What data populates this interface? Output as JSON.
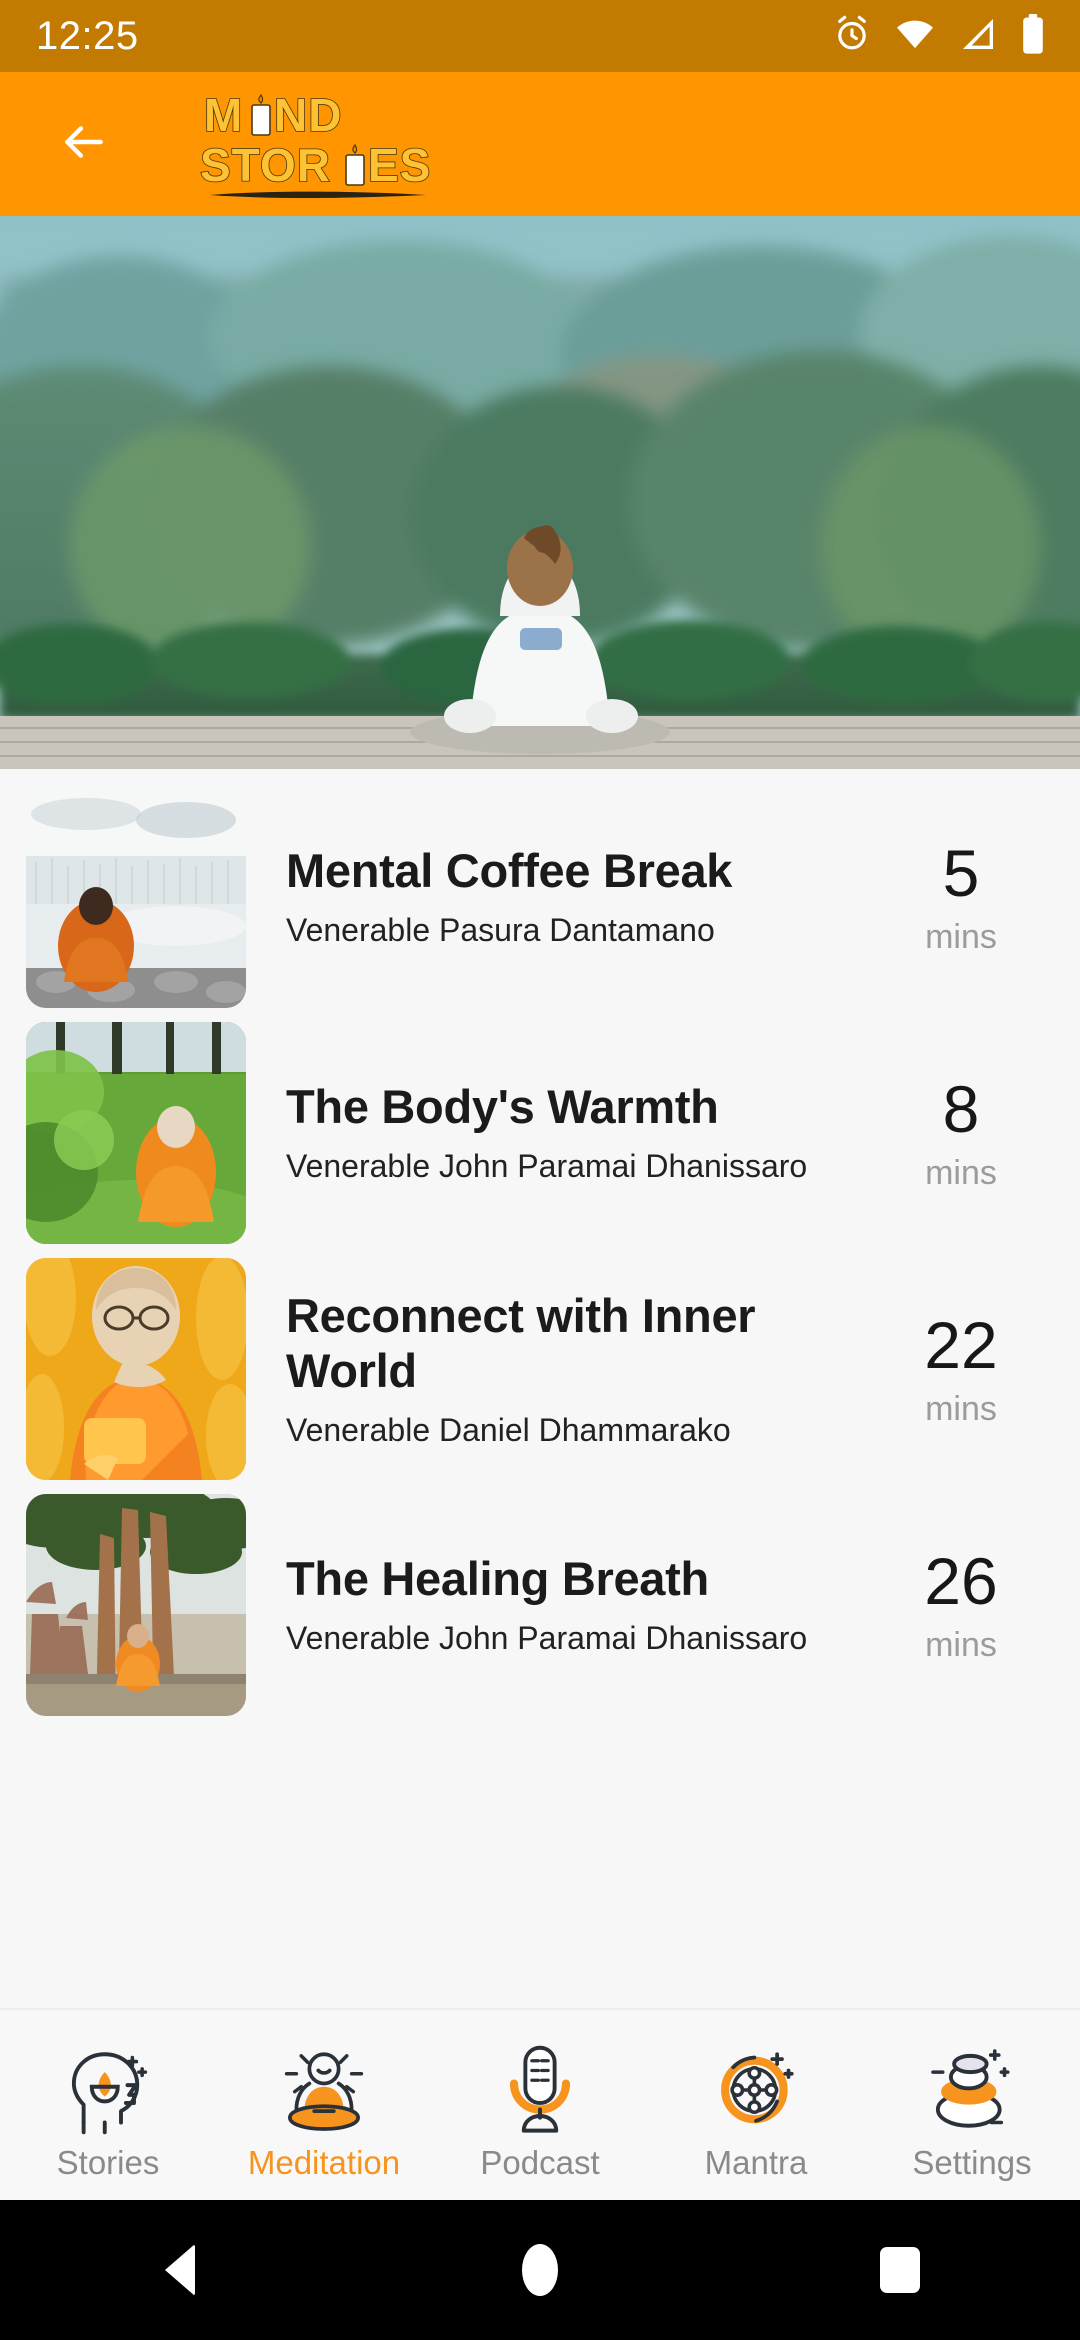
{
  "status_bar": {
    "time": "12:25",
    "icons": [
      "alarm-icon",
      "wifi-icon",
      "signal-icon",
      "battery-icon"
    ],
    "background": "#C27A00"
  },
  "header": {
    "back_icon": "back-arrow-icon",
    "logo_line1": "MIND",
    "logo_line2": "STORIES",
    "background": "#FF9500",
    "logo_fill": "#FFC233"
  },
  "hero": {
    "alt": "person meditating outdoors facing forest"
  },
  "list": {
    "items": [
      {
        "title": "Mental Coffee Break",
        "author": "Venerable Pasura Dantamano",
        "minutes": "5",
        "minutes_label": "mins",
        "thumb": "monk-by-lake"
      },
      {
        "title": "The Body's Warmth",
        "author": "Venerable John Paramai Dhanissaro",
        "minutes": "8",
        "minutes_label": "mins",
        "thumb": "monk-on-grass"
      },
      {
        "title": "Reconnect with Inner World",
        "author": "Venerable Daniel Dhammarako",
        "minutes": "22",
        "minutes_label": "mins",
        "thumb": "monk-portrait-orange"
      },
      {
        "title": "The Healing Breath",
        "author": "Venerable John Paramai Dhanissaro",
        "minutes": "26",
        "minutes_label": "mins",
        "thumb": "monk-under-tree"
      }
    ]
  },
  "bottom_nav": {
    "active_color": "#F7941E",
    "inactive_color": "#8a8a8a",
    "items": [
      {
        "label": "Stories",
        "icon": "head-lotus-icon",
        "active": false
      },
      {
        "label": "Meditation",
        "icon": "seated-monk-icon",
        "active": true
      },
      {
        "label": "Podcast",
        "icon": "microphone-icon",
        "active": false
      },
      {
        "label": "Mantra",
        "icon": "mantra-wheel-icon",
        "active": false
      },
      {
        "label": "Settings",
        "icon": "zen-stones-icon",
        "active": false
      }
    ]
  },
  "system_nav": {
    "back": "back-triangle-icon",
    "home": "home-circle-icon",
    "recents": "recents-square-icon"
  }
}
